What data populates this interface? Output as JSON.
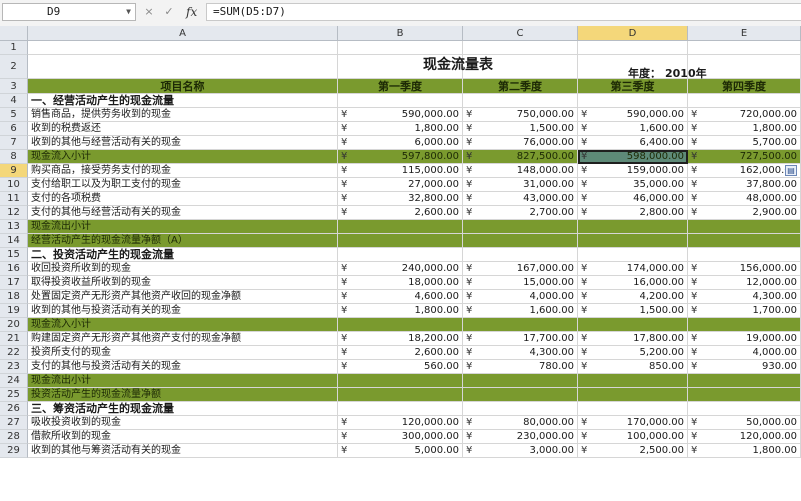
{
  "formula_bar": {
    "cell_ref": "D9",
    "cancel_label": "×",
    "confirm_label": "✓",
    "fx_label": "fx",
    "formula": "=SUM(D5:D7)"
  },
  "sheet": {
    "columns": [
      "A",
      "B",
      "C",
      "D",
      "E"
    ],
    "selected_column": "D",
    "selected_row": "9",
    "title": "现金流量表",
    "year_label": "年度：",
    "year_value": "2010年",
    "rows": [
      {
        "n": "1",
        "type": "blank"
      },
      {
        "n": "2",
        "type": "title"
      },
      {
        "n": "3",
        "type": "header",
        "a": "项目名称",
        "b": "第一季度",
        "c": "第二季度",
        "d": "第三季度",
        "e": "第四季度"
      },
      {
        "n": "4",
        "type": "section",
        "a": "一、经营活动产生的现金流量"
      },
      {
        "n": "5",
        "type": "data",
        "a": "销售商品，提供劳务收到的现金",
        "b": "590,000.00",
        "c": "750,000.00",
        "d": "590,000.00",
        "e": "720,000.00"
      },
      {
        "n": "6",
        "type": "data",
        "a": "收到的税费返还",
        "b": "1,800.00",
        "c": "1,500.00",
        "d": "1,600.00",
        "e": "1,800.00"
      },
      {
        "n": "7",
        "type": "data",
        "a": "收到的其他与经营活动有关的现金",
        "b": "6,000.00",
        "c": "76,000.00",
        "d": "6,400.00",
        "e": "5,700.00"
      },
      {
        "n": "8",
        "type": "green",
        "a": "现金流入小计",
        "b": "597,800.00",
        "c": "827,500.00",
        "d": "598,000.00",
        "e": "727,500.00"
      },
      {
        "n": "9",
        "type": "data",
        "a": "购买商品，接受劳务支付的现金",
        "b": "115,000.00",
        "c": "148,000.00",
        "d": "159,000.00",
        "e": "162,000.00"
      },
      {
        "n": "10",
        "type": "data",
        "a": "支付给职工以及为职工支付的现金",
        "b": "27,000.00",
        "c": "31,000.00",
        "d": "35,000.00",
        "e": "37,800.00"
      },
      {
        "n": "11",
        "type": "data",
        "a": "支付的各项税费",
        "b": "32,800.00",
        "c": "43,000.00",
        "d": "46,000.00",
        "e": "48,000.00"
      },
      {
        "n": "12",
        "type": "data",
        "a": "支付的其他与经营活动有关的现金",
        "b": "2,600.00",
        "c": "2,700.00",
        "d": "2,800.00",
        "e": "2,900.00"
      },
      {
        "n": "13",
        "type": "green",
        "a": "现金流出小计"
      },
      {
        "n": "14",
        "type": "green",
        "a": "经营活动产生的现金流量净额（A）"
      },
      {
        "n": "15",
        "type": "section",
        "a": "二、投资活动产生的现金流量"
      },
      {
        "n": "16",
        "type": "data",
        "a": "收回投资所收到的现金",
        "b": "240,000.00",
        "c": "167,000.00",
        "d": "174,000.00",
        "e": "156,000.00"
      },
      {
        "n": "17",
        "type": "data",
        "a": "取得投资收益所收到的现金",
        "b": "18,000.00",
        "c": "15,000.00",
        "d": "16,000.00",
        "e": "12,000.00"
      },
      {
        "n": "18",
        "type": "data",
        "a": "处置固定资产无形资产其他资产收回的现金净额",
        "b": "4,600.00",
        "c": "4,000.00",
        "d": "4,200.00",
        "e": "4,300.00"
      },
      {
        "n": "19",
        "type": "data",
        "a": "收到的其他与投资活动有关的现金",
        "b": "1,800.00",
        "c": "1,600.00",
        "d": "1,500.00",
        "e": "1,700.00"
      },
      {
        "n": "20",
        "type": "green",
        "a": "现金流入小计"
      },
      {
        "n": "21",
        "type": "data",
        "a": "购建固定资产无形资产其他资产支付的现金净额",
        "b": "18,200.00",
        "c": "17,700.00",
        "d": "17,800.00",
        "e": "19,000.00"
      },
      {
        "n": "22",
        "type": "data",
        "a": "投资所支付的现金",
        "b": "2,600.00",
        "c": "4,300.00",
        "d": "5,200.00",
        "e": "4,000.00"
      },
      {
        "n": "23",
        "type": "data",
        "a": "支付的其他与投资活动有关的现金",
        "b": "560.00",
        "c": "780.00",
        "d": "850.00",
        "e": "930.00"
      },
      {
        "n": "24",
        "type": "green",
        "a": "现金流出小计"
      },
      {
        "n": "25",
        "type": "green",
        "a": "投资活动产生的现金流量净额"
      },
      {
        "n": "26",
        "type": "section",
        "a": "三、筹资活动产生的现金流量"
      },
      {
        "n": "27",
        "type": "data",
        "a": "吸收投资收到的现金",
        "b": "120,000.00",
        "c": "80,000.00",
        "d": "170,000.00",
        "e": "50,000.00"
      },
      {
        "n": "28",
        "type": "data",
        "a": "借款所收到的现金",
        "b": "300,000.00",
        "c": "230,000.00",
        "d": "100,000.00",
        "e": "120,000.00"
      },
      {
        "n": "29",
        "type": "data",
        "a": "收到的其他与筹资活动有关的现金",
        "b": "5,000.00",
        "c": "3,000.00",
        "d": "2,500.00",
        "e": "1,800.00"
      }
    ],
    "currency_symbol": "¥",
    "paste_options_icon": "paste-options-icon"
  }
}
